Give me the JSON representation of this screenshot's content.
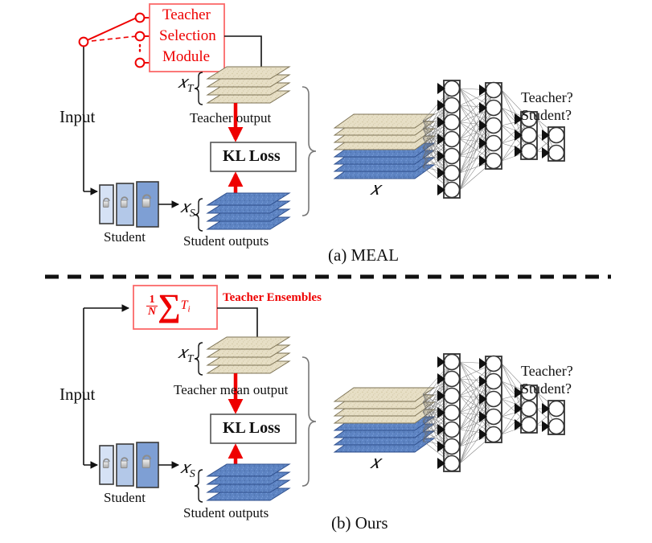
{
  "figure": {
    "caption_a": "(a) MEAL",
    "caption_b": "(b) Ours",
    "divider": "dashed-horizontal-divider"
  },
  "colors": {
    "red": "#ee0000",
    "red_soft": "#fb6a6a",
    "teacher_layer": "#e7dfc6",
    "teacher_layer_edge": "#b9ad83",
    "student_layer": "#5d83c2",
    "student_layer_edge": "#2f4f8c",
    "student_block_1": "#d6e2f5",
    "student_block_2": "#b3c8e8",
    "student_block_3": "#7e9fd4",
    "box_border": "#555555",
    "ink": "#111111"
  },
  "panel_a": {
    "input_label": "Input",
    "teacher_selection_module": {
      "lines": [
        "Teacher",
        "Selection",
        "Module"
      ],
      "switch_nodes": 3,
      "switch_styles": [
        "solid",
        "dashed",
        "dotted"
      ]
    },
    "x_t_label": "ℰT",
    "teacher_output_label": "Teacher output",
    "kl_loss_label": "KL Loss",
    "x_s_label": "ℰS",
    "student_outputs_label": "Student outputs",
    "student_label": "Student",
    "student_blocks": 3,
    "student_block_icon": "unlock-icon",
    "teacher_stack_count": 4,
    "student_stack_count": 4,
    "discriminator": {
      "x_label": "𝑥",
      "combined_teacher_layers": 4,
      "combined_student_layers": 4,
      "layer_sizes": [
        7,
        5,
        3,
        2
      ],
      "question_lines": [
        "Teacher?",
        "Student?"
      ]
    }
  },
  "panel_b": {
    "input_label": "Input",
    "teacher_ensembles": {
      "label": "Teacher Ensembles",
      "formula_numerator": "1",
      "formula_denominator": "N",
      "formula_sigma": "∑",
      "formula_term": "T",
      "formula_sub": "i"
    },
    "x_t_label": "ℰT",
    "teacher_output_label": "Teacher mean output",
    "kl_loss_label": "KL Loss",
    "x_s_label": "ℰS",
    "student_outputs_label": "Student outputs",
    "student_label": "Student",
    "student_blocks": 3,
    "student_block_icon": "unlock-icon",
    "teacher_stack_count": 4,
    "student_stack_count": 4,
    "discriminator": {
      "x_label": "𝑥",
      "combined_teacher_layers": 4,
      "combined_student_layers": 4,
      "layer_sizes": [
        7,
        5,
        3,
        2
      ],
      "question_lines": [
        "Teacher?",
        "Student?"
      ]
    }
  }
}
